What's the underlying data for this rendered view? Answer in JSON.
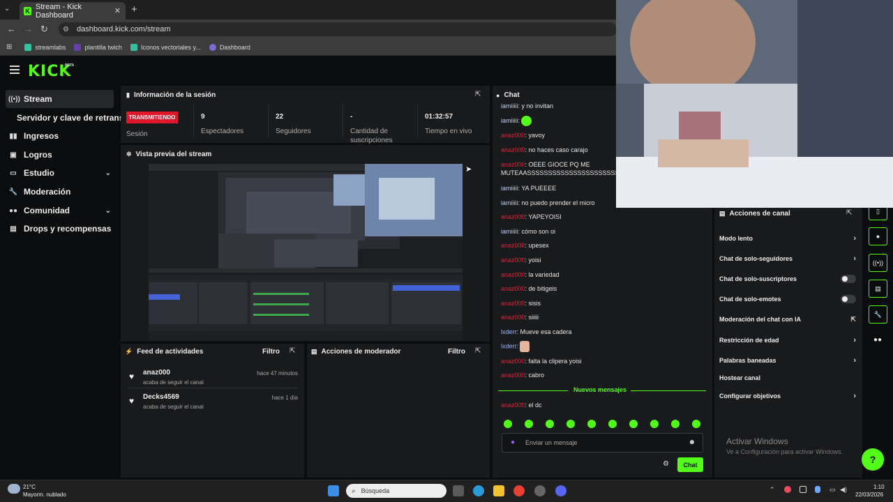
{
  "browser": {
    "tab_title": "Stream - Kick Dashboard",
    "tab_close": "✕",
    "new_tab": "+",
    "url": "dashboard.kick.com/stream",
    "bookmarks": [
      "streamlabs",
      "plantilla twich",
      "Iconos vectoriales y...",
      "Dashboard"
    ]
  },
  "header": {
    "logo": "KICK",
    "beta": "BETA"
  },
  "sidebar": {
    "items": [
      {
        "label": "Stream",
        "icon": "stream-icon"
      },
      {
        "label": "Servidor y clave de retransm"
      },
      {
        "label": "Ingresos",
        "icon": "chart-icon"
      },
      {
        "label": "Logros",
        "icon": "trophy-icon"
      },
      {
        "label": "Estudio",
        "icon": "studio-icon"
      },
      {
        "label": "Moderación",
        "icon": "wrench-icon"
      },
      {
        "label": "Comunidad",
        "icon": "users-icon"
      },
      {
        "label": "Drops y recompensas",
        "icon": "gift-icon"
      }
    ]
  },
  "session": {
    "title": "Información de la sesión",
    "badge": "TRANSMITIENDO",
    "badge_label": "Sesión",
    "stats": [
      {
        "value": "9",
        "label": "Espectadores"
      },
      {
        "value": "22",
        "label": "Seguidores"
      },
      {
        "value": "-",
        "label": "Cantidad de suscripciones"
      },
      {
        "value": "01:32:57",
        "label": "Tiempo en vivo"
      }
    ]
  },
  "preview": {
    "title": "Vista previa del stream"
  },
  "feed": {
    "title": "Feed de actividades",
    "filter": "Filtro",
    "rows": [
      {
        "name": "anaz000",
        "sub": "acaba de seguir el canal",
        "time": "hace 47 minutos"
      },
      {
        "name": "Decks4569",
        "sub": "acaba de seguir el canal",
        "time": "hace 1 día"
      }
    ]
  },
  "mod_actions": {
    "title": "Acciones de moderador",
    "filter": "Filtro"
  },
  "chat": {
    "title": "Chat",
    "messages": [
      {
        "user": "iamiiiii",
        "text": ": y no invitan",
        "color": "light"
      },
      {
        "user": "iamiiiii",
        "text": ":",
        "color": "light",
        "emote": true
      },
      {
        "user": "anaz000",
        "text": ": yavoy",
        "color": "red"
      },
      {
        "user": "anaz000",
        "text": ": no haces caso carajo",
        "color": "red"
      },
      {
        "user": "anaz000",
        "text": ": OEEE GIOCE PQ ME",
        "color": "red"
      },
      {
        "user": "",
        "text": "MUTEAASSSSSSSSSSSSSSSSSSSSSS",
        "color": "red"
      },
      {
        "user": "iamiiiii",
        "text": ": YA PUEEEE",
        "color": "light"
      },
      {
        "user": "iamiiiii",
        "text": ": no puedo prender el micro",
        "color": "light"
      },
      {
        "user": "anaz000",
        "text": ": YAPEYOISI",
        "color": "red"
      },
      {
        "user": "iamiiiii",
        "text": ": cómo son oi",
        "color": "light"
      },
      {
        "user": "anaz000",
        "text": ": upesex",
        "color": "red"
      },
      {
        "user": "anaz000",
        "text": ": yoisi",
        "color": "red"
      },
      {
        "user": "anaz000",
        "text": ": la variedad",
        "color": "red"
      },
      {
        "user": "anaz000",
        "text": ": de bitigeis",
        "color": "red"
      },
      {
        "user": "anaz000",
        "text": ": sisis",
        "color": "red"
      },
      {
        "user": "anaz000",
        "text": ": siiiii",
        "color": "red"
      },
      {
        "user": "lxderr",
        "text": ": Mueve esa cadera",
        "color": "blue"
      },
      {
        "user": "lxderr",
        "text": ":",
        "color": "blue",
        "emote2": true
      },
      {
        "user": "anaz000",
        "text": ": falta la clipera yoisi",
        "color": "red"
      },
      {
        "user": "anaz000",
        "text": ": cabro",
        "color": "red"
      }
    ],
    "new_messages": "Nuevos mensajes",
    "after": {
      "user": "anaz000",
      "text": ": el dc"
    },
    "input_placeholder": "Enviar un mensaje",
    "send": "Chat"
  },
  "canal": {
    "title": "Acciones de canal",
    "rows": [
      {
        "label": "Modo lento",
        "kind": "arrow"
      },
      {
        "label": "Chat de solo-seguidores",
        "kind": "arrow"
      },
      {
        "label": "Chat de solo-suscriptores",
        "kind": "toggle"
      },
      {
        "label": "Chat de solo-emotes",
        "kind": "toggle"
      },
      {
        "label": "Moderación del chat con IA",
        "kind": "external"
      },
      {
        "label": "Restricción de edad",
        "kind": "arrow"
      },
      {
        "label": "Palabras baneadas",
        "kind": "arrow"
      },
      {
        "label": "Hostear canal",
        "kind": "none"
      },
      {
        "label": "Configurar objetivos",
        "kind": "arrow"
      }
    ]
  },
  "windows": {
    "activate_title": "Activar Windows",
    "activate_sub": "Ve a Configuración para activar Windows.",
    "search": "Búsqueda",
    "weather_temp": "21°C",
    "weather_desc": "Mayorm. nublado",
    "time": "1:10",
    "date": "22/03/2026"
  },
  "colors": {
    "accent": "#53fc18",
    "live": "#e2162b",
    "user_red": "#e0243a"
  }
}
